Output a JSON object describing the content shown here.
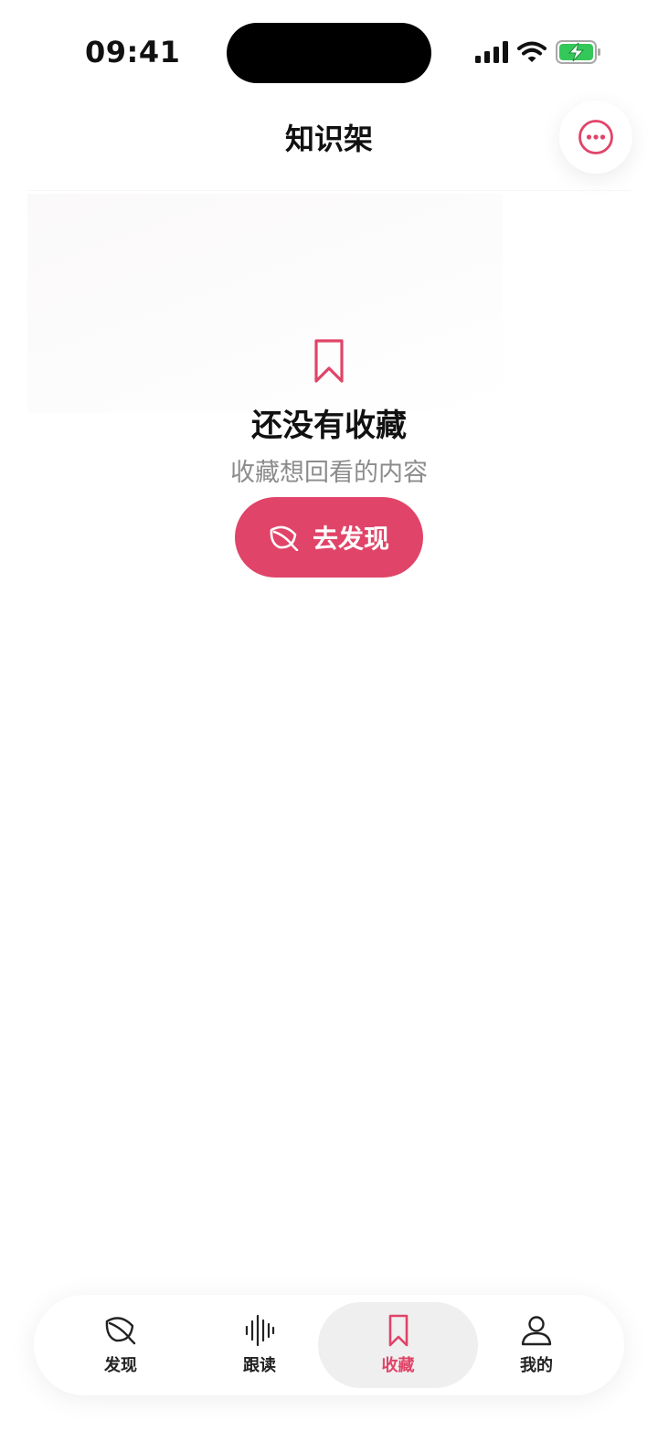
{
  "status_bar": {
    "time": "09:41"
  },
  "header": {
    "title": "知识架"
  },
  "empty_state": {
    "title": "还没有收藏",
    "subtitle": "收藏想回看的内容",
    "button_label": "去发现"
  },
  "bottom_nav": {
    "items": [
      {
        "label": "发现",
        "icon": "leaf-icon"
      },
      {
        "label": "跟读",
        "icon": "waveform-icon"
      },
      {
        "label": "收藏",
        "icon": "bookmark-icon",
        "active": true
      },
      {
        "label": "我的",
        "icon": "person-icon"
      }
    ]
  },
  "colors": {
    "accent": "#e04468",
    "battery": "#34c759",
    "muted_text": "#8c8c8c"
  }
}
